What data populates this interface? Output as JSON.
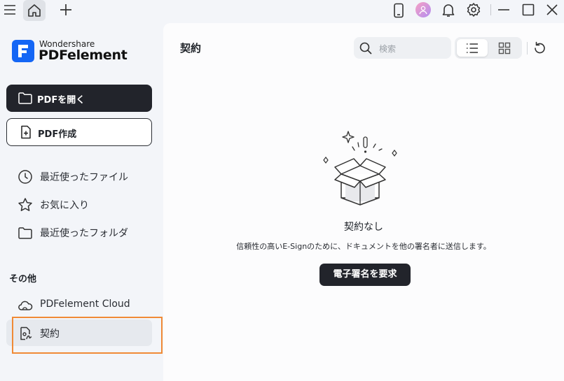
{
  "titlebar": {
    "icons": [
      "menu-icon",
      "home-icon",
      "plus-icon",
      "tablet-icon",
      "avatar",
      "bell-icon",
      "gear-icon",
      "minimize-icon",
      "maximize-icon",
      "close-icon"
    ]
  },
  "brand": {
    "company": "Wondershare",
    "product": "PDFelement"
  },
  "sidebar": {
    "open_pdf": "PDFを開く",
    "create_pdf": "PDF作成",
    "items": [
      {
        "label": "最近使ったファイル",
        "icon": "clock-icon"
      },
      {
        "label": "お気に入り",
        "icon": "star-icon"
      },
      {
        "label": "最近使ったフォルダ",
        "icon": "folder-icon"
      }
    ],
    "section_title": "その他",
    "other_items": [
      {
        "label": "PDFelement Cloud",
        "icon": "cloud-icon"
      },
      {
        "label": "契約",
        "icon": "contract-icon",
        "active": true
      }
    ]
  },
  "main": {
    "title": "契約",
    "search_placeholder": "検索",
    "view_mode": "list",
    "empty_title": "契約なし",
    "empty_desc": "信頼性の高いE-Signのために、ドキュメントを他の署名者に送信します。",
    "request_button": "電子署名を要求"
  },
  "colors": {
    "accent_dark": "#22242b",
    "brand_blue": "#1466f5",
    "highlight": "#f08a36"
  }
}
